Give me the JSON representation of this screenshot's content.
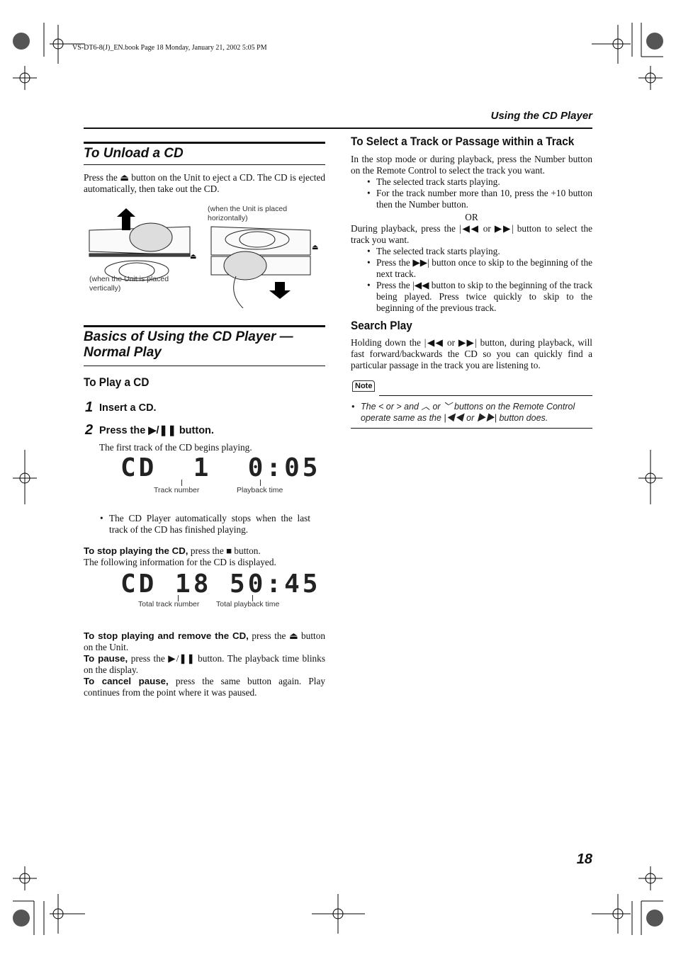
{
  "header": {
    "file_info": "VS-DT6-8(J)_EN.book  Page 18  Monday, January 21, 2002  5:05 PM",
    "section": "Using the CD Player"
  },
  "unload": {
    "title": "To Unload a CD",
    "text": "Press the ⏏ button on the Unit to eject a CD. The CD is ejected automatically, then take out the CD.",
    "caption_horizontal": "(when the Unit is placed horizontally)",
    "caption_vertical": "(when the Unit is placed vertically)"
  },
  "basics": {
    "title": "Basics of Using the CD Player — Normal Play",
    "subtitle": "To Play a CD",
    "step1_num": "1",
    "step1": "Insert a CD.",
    "step2_num": "2",
    "step2": "Press the ▶/❚❚ button.",
    "step2_text": "The first track of the CD begins playing.",
    "display1": "CD  1  0:05",
    "display1_label1": "Track number",
    "display1_label2": "Playback time",
    "bullet": "The CD Player automatically stops when the last track of the CD has finished playing.",
    "stop_label": "To stop playing the CD,",
    "stop_text": " press the ■ button.",
    "stop_text2": "The following information for the CD is displayed.",
    "display2": "CD 18 50:45",
    "display2_label1": "Total track number",
    "display2_label2": "Total playback time",
    "remove_label": "To stop playing and remove the CD,",
    "remove_text": " press the ⏏ button on the Unit.",
    "pause_label": "To pause,",
    "pause_text": " press the ▶/❚❚ button. The playback time blinks on the display.",
    "cancel_label": "To cancel pause,",
    "cancel_text": " press the same button again. Play continues from the point where it was paused."
  },
  "select": {
    "title": "To Select a Track or Passage within a Track",
    "text1": "In the stop mode or during playback, press the Number button on the Remote Control to select the track you want.",
    "bullets1": [
      "The selected track starts playing.",
      "For the track number more than 10, press the +10 button then the Number button."
    ],
    "or": "OR",
    "text2": "During playback, press the |◀◀ or ▶▶| button to select the track you want.",
    "bullets2": [
      "The selected track starts playing.",
      "Press the ▶▶| button once to skip to the beginning of the next track.",
      "Press the |◀◀ button to skip to the beginning of the track being played. Press twice quickly to skip to the beginning of the previous track."
    ]
  },
  "search": {
    "title": "Search Play",
    "text": "Holding down the |◀◀ or ▶▶| button, during playback, will fast forward/backwards the CD so you can quickly find a particular passage in the track you are listening to."
  },
  "note": {
    "label": "Note",
    "text": "The < or > and ︿ or ﹀ buttons on the Remote Control operate same as the |◀◀ or ▶▶| button does."
  },
  "page_number": "18"
}
